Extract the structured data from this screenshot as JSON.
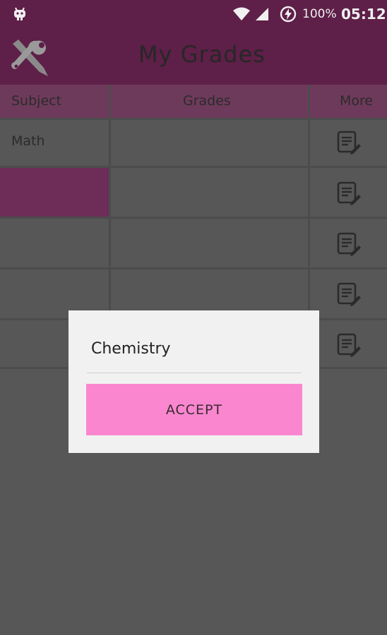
{
  "status_bar": {
    "battery": "100%",
    "time": "05:12",
    "icons": [
      "android-icon",
      "wifi-icon",
      "signal-icon",
      "charging-icon"
    ]
  },
  "app_bar": {
    "title": "My Grades",
    "icon": "tools-icon"
  },
  "table": {
    "headers": [
      "Subject",
      "Grades",
      "More"
    ],
    "rows": [
      {
        "subject": "Math",
        "grades": "",
        "more_icon": "edit-list-icon"
      },
      {
        "subject": "",
        "grades": "",
        "more_icon": "edit-list-icon"
      },
      {
        "subject": "",
        "grades": "",
        "more_icon": "edit-list-icon"
      },
      {
        "subject": "",
        "grades": "",
        "more_icon": "edit-list-icon"
      },
      {
        "subject": "",
        "grades": "",
        "more_icon": "edit-list-icon"
      }
    ]
  },
  "dialog": {
    "input_value": "Chemistry",
    "accept_label": "ACCEPT"
  },
  "colors": {
    "primary": "#5e1f48",
    "accent": "#fa86cf",
    "overlay": "#575757"
  }
}
